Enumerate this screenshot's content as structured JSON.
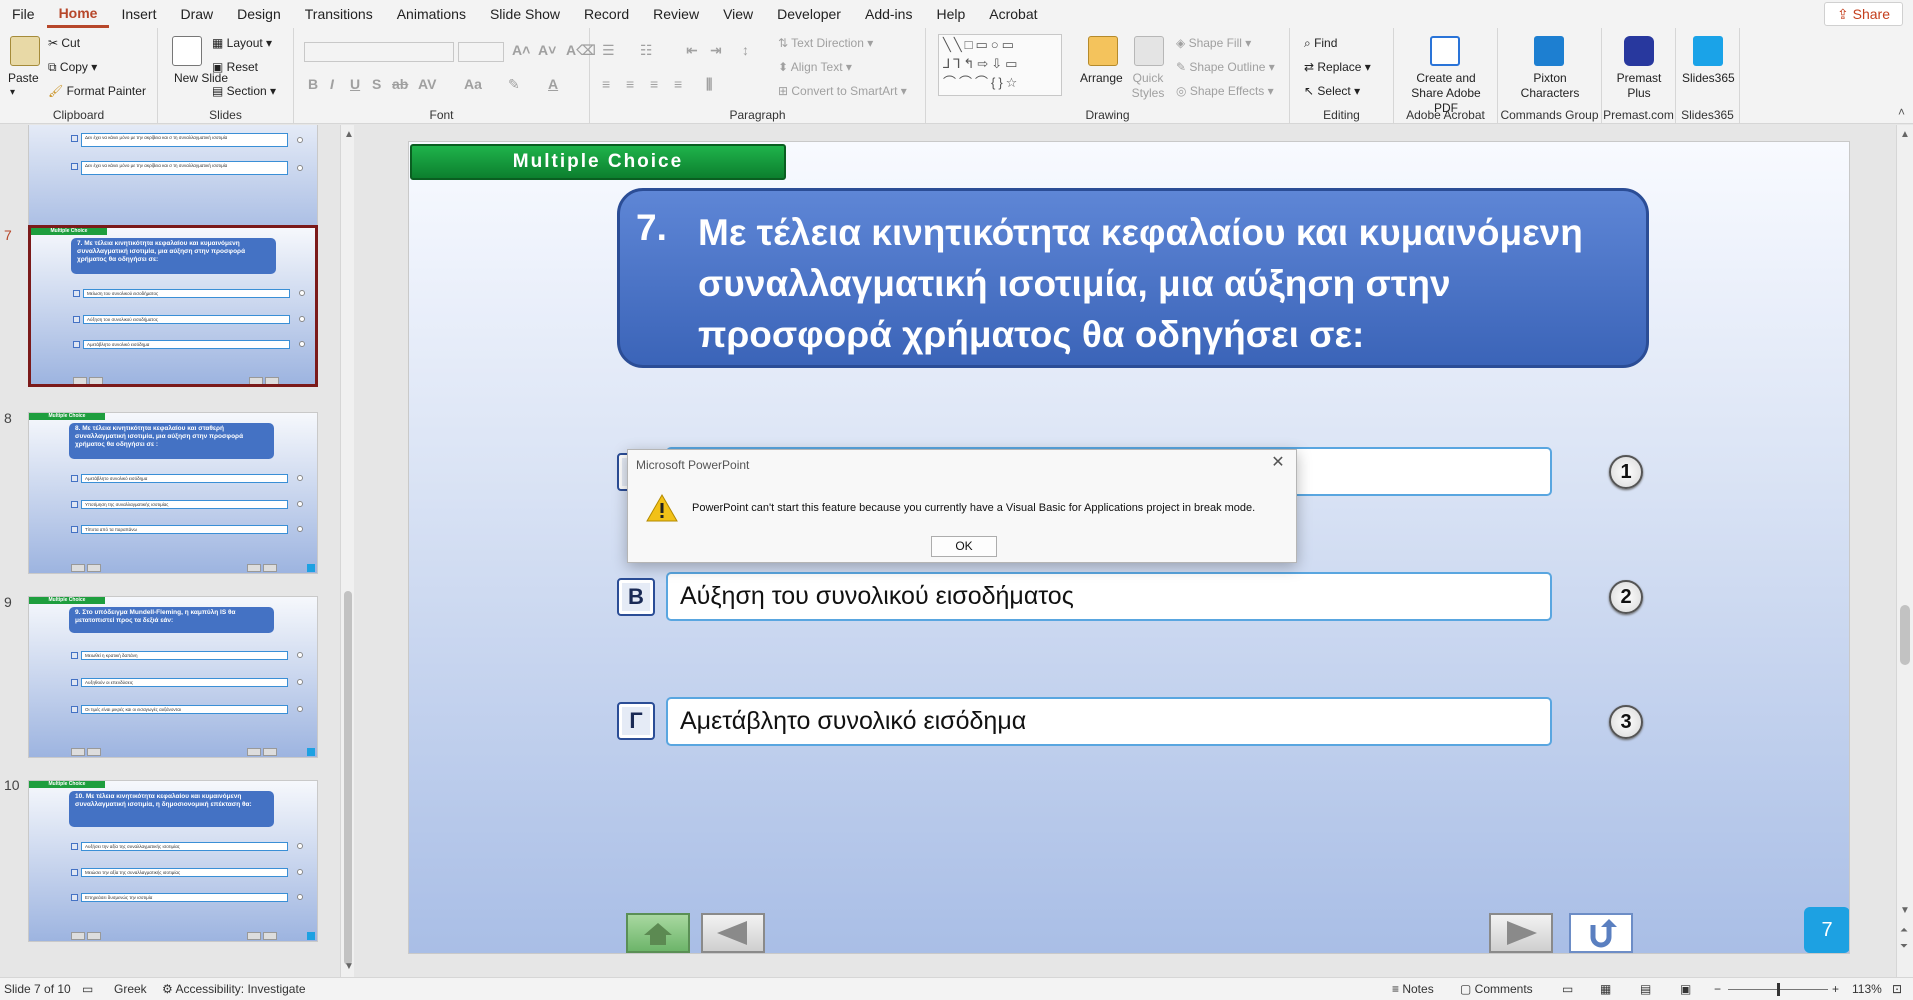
{
  "menu": {
    "tabs": [
      "File",
      "Home",
      "Insert",
      "Draw",
      "Design",
      "Transitions",
      "Animations",
      "Slide Show",
      "Record",
      "Review",
      "View",
      "Developer",
      "Add-ins",
      "Help",
      "Acrobat"
    ],
    "active_tab": "Home",
    "share_label": "Share"
  },
  "ribbon": {
    "clipboard": {
      "label": "Clipboard",
      "paste": "Paste",
      "cut": "Cut",
      "copy": "Copy",
      "format_painter": "Format Painter"
    },
    "slides": {
      "label": "Slides",
      "new_slide": "New Slide",
      "layout": "Layout",
      "reset": "Reset",
      "section": "Section"
    },
    "font": {
      "label": "Font"
    },
    "paragraph": {
      "label": "Paragraph",
      "text_direction": "Text Direction",
      "align_text": "Align Text",
      "convert_smartart": "Convert to SmartArt"
    },
    "drawing": {
      "label": "Drawing",
      "arrange": "Arrange",
      "quick_styles": "Quick Styles",
      "shape_fill": "Shape Fill",
      "shape_outline": "Shape Outline",
      "shape_effects": "Shape Effects"
    },
    "editing": {
      "label": "Editing",
      "find": "Find",
      "replace": "Replace",
      "select": "Select"
    },
    "adobe": {
      "label": "Adobe Acrobat",
      "create_share": "Create and Share Adobe PDF"
    },
    "commands": {
      "label": "Commands Group",
      "pixton": "Pixton Characters"
    },
    "premast": {
      "label": "Premast.com",
      "premast_plus": "Premast Plus"
    },
    "slides365": {
      "label": "Slides365",
      "button": "Slides365"
    }
  },
  "thumbnails": [
    {
      "number": "",
      "question": "",
      "options": [
        "Δεν έχει να κάνει μόνο με την ακρίβεια και σ τη συναλλαγματική ισοτιμία",
        "Δεν έχει να κάνει μόνο με την ακρίβεια και σ τη συναλλαγματική ισοτιμία"
      ]
    },
    {
      "number": "7",
      "question": "7.  Με τέλεια κινητικότητα κεφαλαίου και κυμαινόμενη συναλλαγματική ισοτιμία, μια αύξηση στην προσφορά χρήματος θα οδηγήσει σε:",
      "options": [
        "Μείωση του συνολικού εισοδήματος",
        "Αύξηση του συνολικού εισοδήματος",
        "Αμετάβλητο συνολικό εισόδημα"
      ]
    },
    {
      "number": "8",
      "question": "8.  Με τέλεια κινητικότητα κεφαλαίου και σταθερή συναλλαγματική ισοτιμία, μια αύξηση στην προσφορά χρήματος θα οδηγήσει σε :",
      "options": [
        "Αμετάβλητο συνολικό εισόδημα",
        "Υποτίμηση της συναλλαγματικής ισοτιμίας",
        "Τίποτα από τα παραπάνω"
      ]
    },
    {
      "number": "9",
      "question": "9.  Στο υπόδειγμα Mundell-Fleming, η καμπύλη IS  θα μετατοπιστεί προς τα δεξιά εάν:",
      "options": [
        "Μειωθεί η κρατική δαπάνη",
        "Αυξηθούν οι επενδύσεις",
        "Οι τιμές είναι μικρές και οι εισαγωγές αυξάνονται"
      ]
    },
    {
      "number": "10",
      "question": "10. Με τέλεια κινητικότητα κεφαλαίου και κυμαινόμενη συναλλαγματική ισοτιμία, η δημοσιονομική επέκταση θα:",
      "options": [
        "Αυξήσει την αξία της συναλλαγματικής ισοτιμίας",
        "Μειώσει την αξία της συναλλαγματικής ισοτιμίας",
        "Επηρεάσει δυσμενώς την ισοτιμία"
      ]
    }
  ],
  "slide": {
    "banner": "Multiple Choice",
    "question_number": "7.",
    "question_text": "Με τέλεια κινητικότητα κεφαλαίου και κυμαινόμενη συναλλαγματική ισοτιμία, μια αύξηση στην προσφορά χρήματος θα οδηγήσει σε:",
    "options": [
      {
        "letter": "Α",
        "text": "Μείωση του συνολικού εισοδήματος",
        "number": "1"
      },
      {
        "letter": "Β",
        "text": "Αύξηση του συνολικού εισοδήματος",
        "number": "2"
      },
      {
        "letter": "Γ",
        "text": "Αμετάβλητο συνολικό εισόδημα",
        "number": "3"
      }
    ],
    "slide_badge": "7"
  },
  "dialog": {
    "title": "Microsoft PowerPoint",
    "message": "PowerPoint can't start this feature because you currently have a Visual Basic for Applications project in break mode.",
    "ok_label": "OK"
  },
  "status": {
    "slide_info": "Slide 7 of 10",
    "language": "Greek",
    "accessibility": "Accessibility: Investigate",
    "notes": "Notes",
    "comments": "Comments",
    "zoom": "113%"
  },
  "colors": {
    "accent": "#b7472a",
    "banner_green": "#1e9e3e",
    "question_blue": "#4472c4",
    "badge_blue": "#1da1e2"
  }
}
